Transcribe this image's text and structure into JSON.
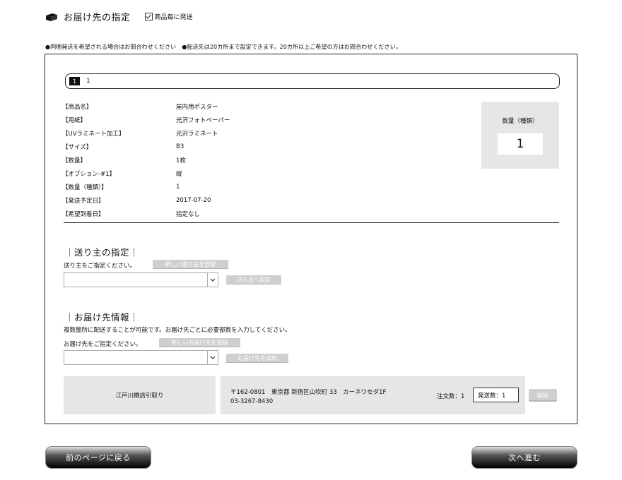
{
  "header": {
    "title": "お届け先の指定",
    "ship_each_label": "商品毎に発送",
    "ship_each_checked": true
  },
  "notice": "●同梱発送を希望される場合はお問合わせください　●配送先は20カ所まで設定できます。20カ所以上ご希望の方はお問合わせください。",
  "pager": {
    "current": "1",
    "label": "1"
  },
  "product_details": [
    {
      "label": "【商品名】",
      "value": "屋内用ポスター"
    },
    {
      "label": "【用紙】",
      "value": "光沢フォトペーパー"
    },
    {
      "label": "【UVラミネート加工】",
      "value": "光沢ラミネート"
    },
    {
      "label": "【サイズ】",
      "value": "B3"
    },
    {
      "label": "【数量】",
      "value": "1枚"
    },
    {
      "label": "【オプション-#1】",
      "value": "縦"
    },
    {
      "label": "【数量（種類）】",
      "value": "1"
    },
    {
      "label": "【発送予定日】",
      "value": "2017-07-20"
    },
    {
      "label": "【希望到着日】",
      "value": "指定なし"
    }
  ],
  "qty_box": {
    "label": "数量（種類）",
    "value": "1"
  },
  "sender": {
    "heading": "｜送り主の指定｜",
    "prompt": "送り主をご指定ください。",
    "new_button": "新しい送り主を登録",
    "select_value": "",
    "set_button": "送り主へ設定"
  },
  "destination": {
    "heading": "｜お届け先情報｜",
    "description": "複数箇所に配送することが可能です。お届け先ごとに必要部数を入力してください。",
    "prompt": "お届け先をご指定ください。",
    "new_button": "新しいお届け先を登録",
    "select_value": "",
    "add_button": "お届け先を追加"
  },
  "delivery_row": {
    "pickup": "江戸川橋店引取り",
    "address_line1": "〒162-0801　東京都 新宿区山吹町 33　カーネワセダ1F",
    "address_line2": "03-3267-8430",
    "order_qty": "注文数：1",
    "ship_qty": "発送数：1",
    "delete_button": "削除"
  },
  "nav": {
    "back": "前のページに戻る",
    "next": "次へ進む"
  }
}
